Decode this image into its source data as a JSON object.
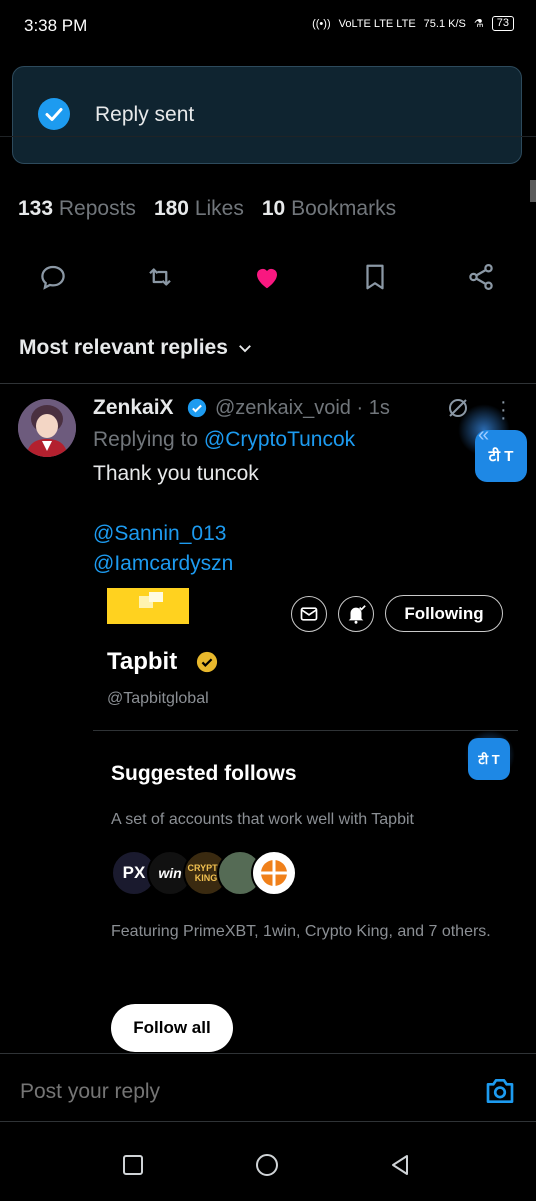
{
  "status_bar": {
    "time": "3:38 PM",
    "network": "VoLTE LTE LTE",
    "speed": "75.1 K/S",
    "battery": "73"
  },
  "toast": {
    "text": "Reply sent"
  },
  "stats": [
    {
      "count": "133",
      "label": "Reposts"
    },
    {
      "count": "180",
      "label": "Likes"
    },
    {
      "count": "10",
      "label": "Bookmarks"
    }
  ],
  "action_bar": {
    "icons": [
      "reply-icon",
      "repost-icon",
      "like-icon",
      "bookmark-icon",
      "share-icon"
    ],
    "like_color": "#f91880"
  },
  "replies_sort": {
    "label": "Most relevant replies"
  },
  "reply": {
    "name": "ZenkaiX",
    "handle": "@zenkaix_void · 1s",
    "replying_prefix": "Replying to ",
    "replying_to": "@CryptoTuncok",
    "text": "Thank you tuncok",
    "mentions": [
      "@Sannin_013",
      "@Iamcardyszn"
    ]
  },
  "ad": {
    "name": "Tapbit",
    "handle": "@Tapbitglobal",
    "follow_label": "Following"
  },
  "suggested": {
    "title": "Suggested follows",
    "description": "A set of accounts that work well with Tapbit",
    "avatars": [
      "PX",
      "win",
      "CRYPTO KING",
      "",
      ""
    ],
    "featuring": "Featuring PrimeXBT, 1win, Crypto King, and 7 others.",
    "follow_all_label": "Follow all"
  },
  "reply_composer": {
    "placeholder": "Post your reply"
  },
  "translate_badge": {
    "label": "टी T"
  },
  "colors": {
    "accent": "#1d9bf0",
    "verified_gold": "#e8b82c",
    "background": "#000000"
  }
}
